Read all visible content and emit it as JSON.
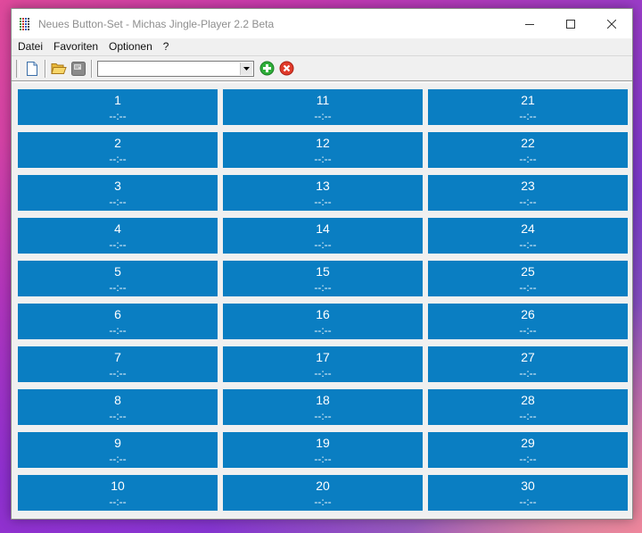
{
  "window": {
    "title": "Neues Button-Set - Michas Jingle-Player 2.2 Beta"
  },
  "menu": [
    "Datei",
    "Favoriten",
    "Optionen",
    "?"
  ],
  "toolbar": {
    "combo_value": ""
  },
  "buttons": [
    {
      "number": "1",
      "time": "--:--"
    },
    {
      "number": "2",
      "time": "--:--"
    },
    {
      "number": "3",
      "time": "--:--"
    },
    {
      "number": "4",
      "time": "--:--"
    },
    {
      "number": "5",
      "time": "--:--"
    },
    {
      "number": "6",
      "time": "--:--"
    },
    {
      "number": "7",
      "time": "--:--"
    },
    {
      "number": "8",
      "time": "--:--"
    },
    {
      "number": "9",
      "time": "--:--"
    },
    {
      "number": "10",
      "time": "--:--"
    },
    {
      "number": "11",
      "time": "--:--"
    },
    {
      "number": "12",
      "time": "--:--"
    },
    {
      "number": "13",
      "time": "--:--"
    },
    {
      "number": "14",
      "time": "--:--"
    },
    {
      "number": "15",
      "time": "--:--"
    },
    {
      "number": "16",
      "time": "--:--"
    },
    {
      "number": "17",
      "time": "--:--"
    },
    {
      "number": "18",
      "time": "--:--"
    },
    {
      "number": "19",
      "time": "--:--"
    },
    {
      "number": "20",
      "time": "--:--"
    },
    {
      "number": "21",
      "time": "--:--"
    },
    {
      "number": "22",
      "time": "--:--"
    },
    {
      "number": "23",
      "time": "--:--"
    },
    {
      "number": "24",
      "time": "--:--"
    },
    {
      "number": "25",
      "time": "--:--"
    },
    {
      "number": "26",
      "time": "--:--"
    },
    {
      "number": "27",
      "time": "--:--"
    },
    {
      "number": "28",
      "time": "--:--"
    },
    {
      "number": "29",
      "time": "--:--"
    },
    {
      "number": "30",
      "time": "--:--"
    }
  ],
  "colors": {
    "button_bg": "#0a7ec2",
    "button_text": "#ffffff",
    "window_bg": "#f0f0f0"
  },
  "icons": {
    "new": "new-file-icon",
    "open": "open-folder-icon",
    "save": "save-icon",
    "add": "add-icon",
    "remove": "remove-icon",
    "minimize": "minimize-icon",
    "maximize": "maximize-icon",
    "close": "close-icon"
  }
}
